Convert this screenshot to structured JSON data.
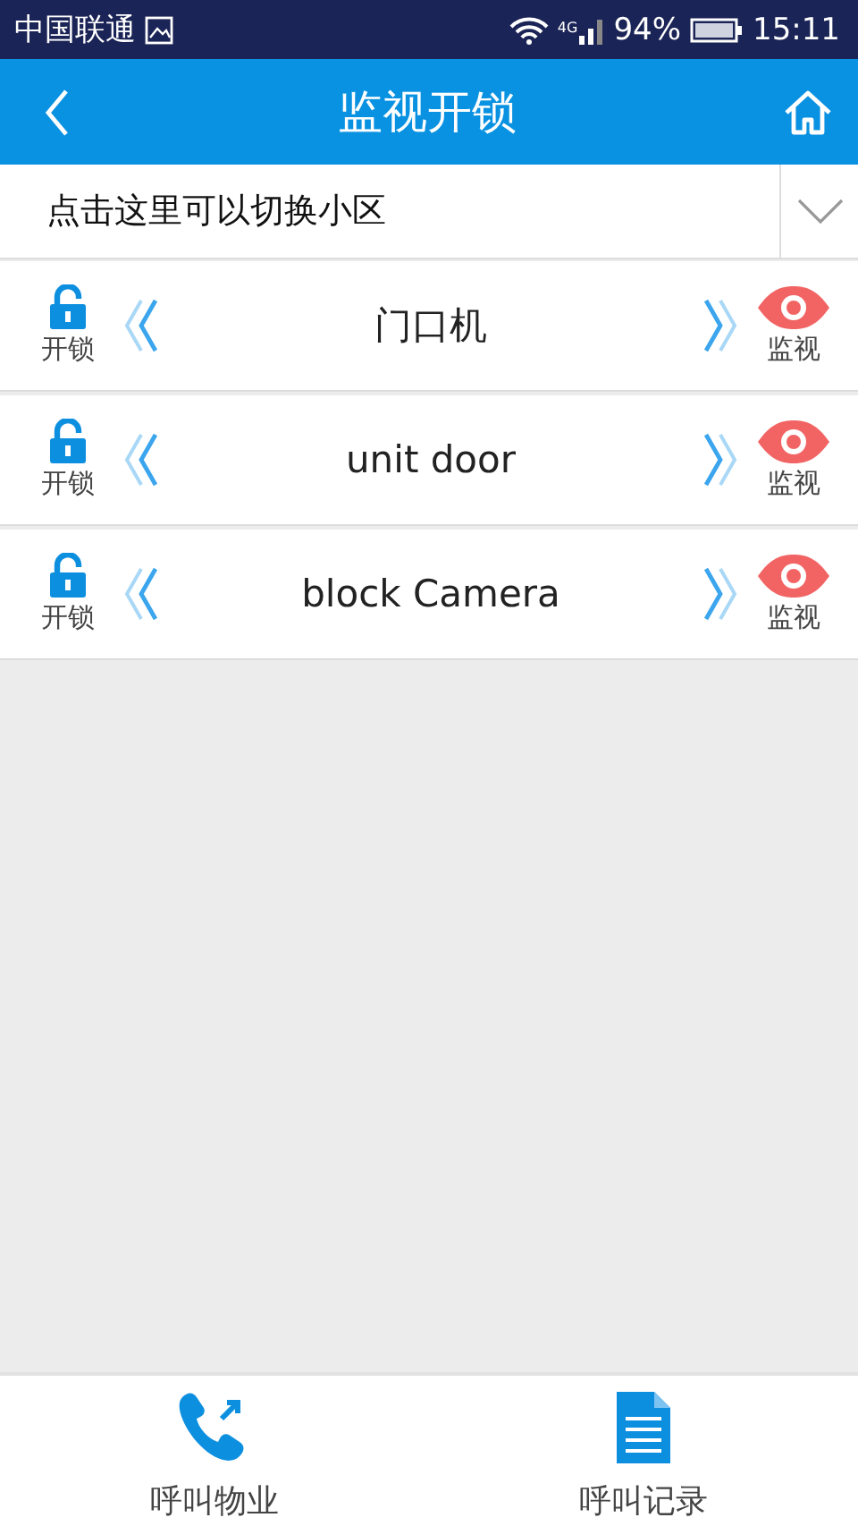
{
  "status_bar": {
    "carrier": "中国联通",
    "network": "4G",
    "battery": "94%",
    "time": "15:11"
  },
  "header": {
    "title": "监视开锁"
  },
  "community_selector": {
    "label": "点击这里可以切换小区"
  },
  "devices": [
    {
      "name": "门口机",
      "unlock_label": "开锁",
      "monitor_label": "监视"
    },
    {
      "name": "unit door",
      "unlock_label": "开锁",
      "monitor_label": "监视"
    },
    {
      "name": "block Camera",
      "unlock_label": "开锁",
      "monitor_label": "监视"
    }
  ],
  "bottom_bar": [
    {
      "kind": "phone",
      "label": "呼叫物业"
    },
    {
      "kind": "document",
      "label": "呼叫记录"
    }
  ]
}
